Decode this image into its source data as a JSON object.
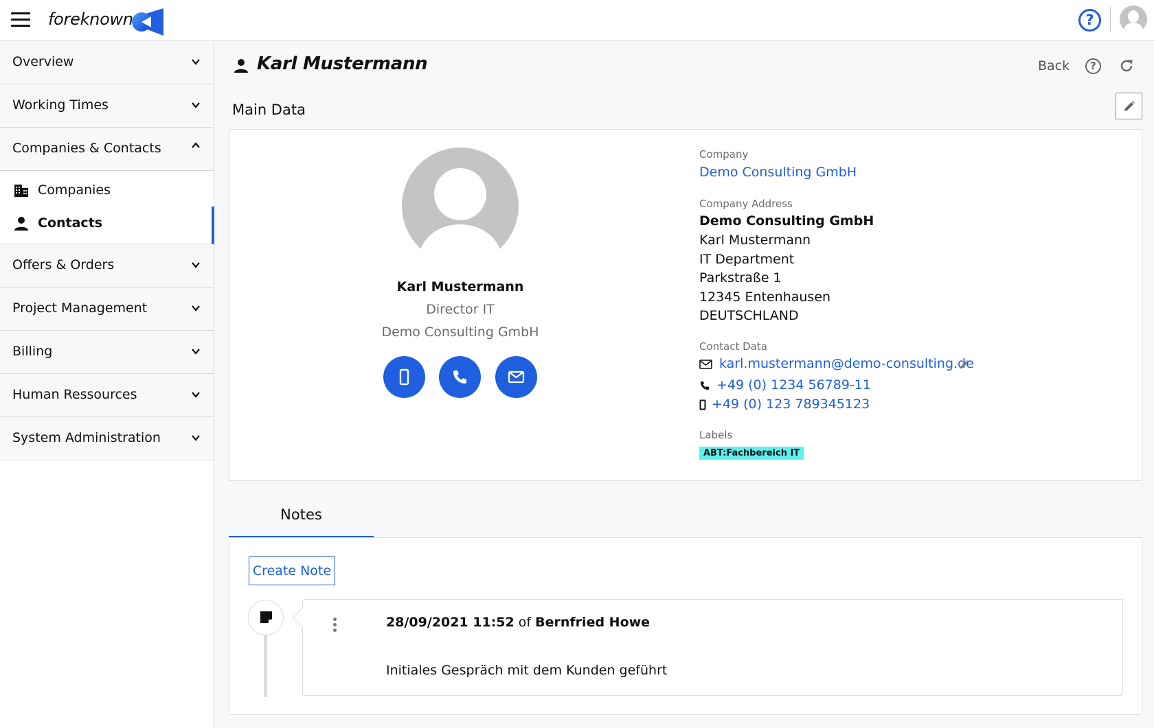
{
  "app": {
    "brand": "foreknown",
    "colors": {
      "accent": "#1f5fe0",
      "label_badge": "#5ef0ee",
      "avatar": "#c4c4c4"
    }
  },
  "header": {
    "menu_icon": "hamburger-icon",
    "help_icon": "help-circle-icon",
    "avatar_icon": "user-avatar-icon"
  },
  "sidebar": {
    "groups": [
      {
        "label": "Overview",
        "expanded": false
      },
      {
        "label": "Working Times",
        "expanded": false
      },
      {
        "label": "Companies & Contacts",
        "expanded": true,
        "items": [
          {
            "label": "Companies",
            "icon": "building-icon",
            "active": false
          },
          {
            "label": "Contacts",
            "icon": "person-icon",
            "active": true
          }
        ]
      },
      {
        "label": "Offers & Orders",
        "expanded": false
      },
      {
        "label": "Project Management",
        "expanded": false
      },
      {
        "label": "Billing",
        "expanded": false
      },
      {
        "label": "Human Ressources",
        "expanded": false
      },
      {
        "label": "System Administration",
        "expanded": false
      }
    ]
  },
  "page": {
    "title": "Karl Mustermann",
    "back_label": "Back"
  },
  "main_data": {
    "section_title": "Main Data",
    "person": {
      "name": "Karl Mustermann",
      "role": "Director IT",
      "company": "Demo Consulting GmbH"
    },
    "actions": [
      "mobile-icon",
      "phone-icon",
      "email-icon"
    ],
    "company_label": "Company",
    "company_value": "Demo Consulting GmbH",
    "address_label": "Company Address",
    "address_lines": [
      "Demo Consulting GmbH",
      "Karl Mustermann",
      "IT Department",
      "Parkstraße 1",
      "12345 Entenhausen",
      "DEUTSCHLAND"
    ],
    "contact_label": "Contact Data",
    "email": "karl.mustermann@demo-consulting.de",
    "phone": "+49 (0) 1234 56789-11",
    "mobile": "+49 (0) 123 789345123",
    "labels_label": "Labels",
    "labels": [
      "ABT:Fachbereich IT"
    ]
  },
  "notes": {
    "tab_label": "Notes",
    "create_label": "Create Note",
    "entries": [
      {
        "date": "28/09/2021 11:52",
        "of": "of",
        "author": "Bernfried Howe",
        "text": "Initiales Gespräch mit dem Kunden geführt"
      }
    ]
  }
}
